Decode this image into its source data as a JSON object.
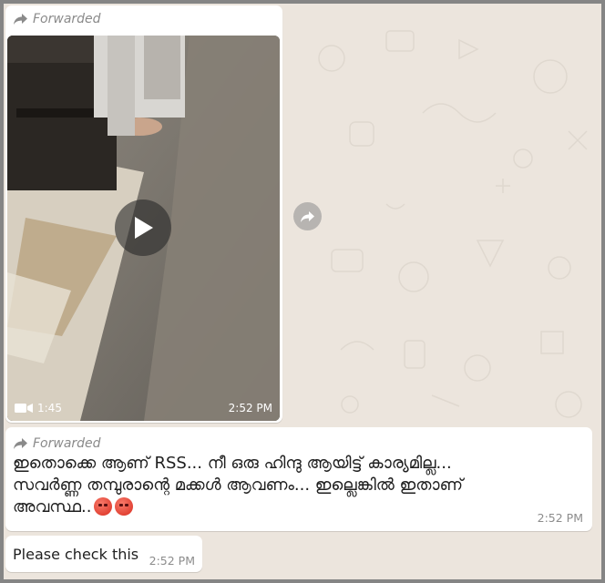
{
  "colors": {
    "chat_background": "#ece5dd",
    "bubble_background": "#ffffff",
    "meta_text": "#8c8c8c",
    "frame_border": "#858585"
  },
  "messages": [
    {
      "type": "video",
      "forwarded_label": "Forwarded",
      "duration": "1:45",
      "time": "2:52 PM",
      "icons": [
        "forward-icon",
        "play-icon",
        "video-camera-icon",
        "share-icon"
      ]
    },
    {
      "type": "text",
      "forwarded_label": "Forwarded",
      "lines": [
        "ഇതൊക്കെ ആണ് RSS... നീ ഒരു ഹിന്ദു ആയിട്ട് കാര്യമില്ല...",
        "സവർണ്ണ തമ്പുരാന്റെ മക്കൾ ആവണം... ഇല്ലെങ്കിൽ ഇതാണ്",
        "അവസ്ഥ.."
      ],
      "emoji": [
        "angry-face-emoji",
        "angry-face-emoji"
      ],
      "time": "2:52 PM"
    },
    {
      "type": "text",
      "text": "Please check this",
      "time": "2:52 PM"
    }
  ]
}
